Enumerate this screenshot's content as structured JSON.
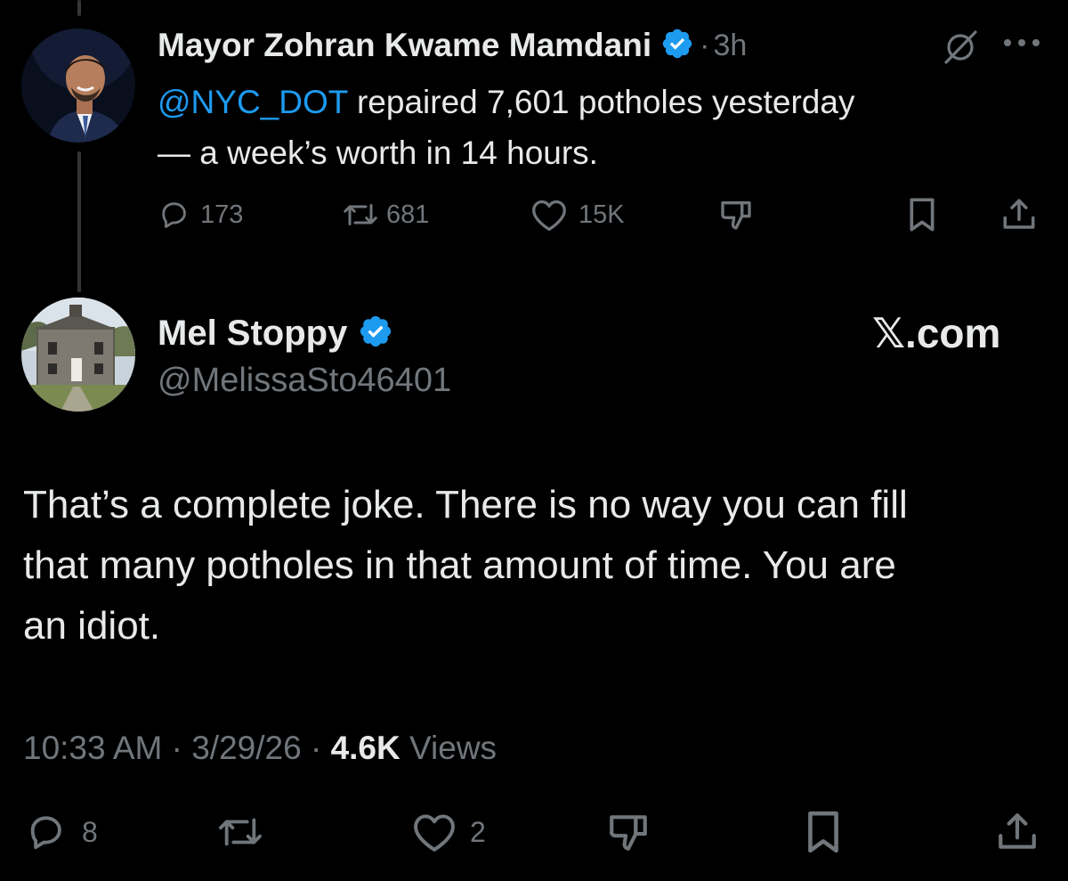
{
  "original_tweet": {
    "author_name": "Mayor Zohran Kwame Mamdani",
    "separator": "·",
    "time": "3h",
    "mention": "@NYC_DOT",
    "text_line1": " repaired 7,601 potholes yesterday",
    "text_line2": "— a week’s worth in 14 hours.",
    "stats": {
      "replies": "173",
      "reposts": "681",
      "likes": "15K"
    },
    "icons": [
      "grok-icon",
      "more-icon",
      "reply-icon",
      "repost-icon",
      "like-icon",
      "dislike-icon",
      "bookmark-icon",
      "share-icon"
    ]
  },
  "reply_tweet": {
    "author_name": "Mel Stoppy",
    "handle": "@MelissaSto46401",
    "watermark": "𝕏.com",
    "text_line1": "That’s a complete joke. There is no way you can fill",
    "text_line2": "that many potholes in that amount of time. You are",
    "text_line3": "an idiot.",
    "meta": {
      "time": "10:33 AM",
      "sep1": "·",
      "date": "3/29/26",
      "sep2": "·",
      "views_count": "4.6K",
      "views_label": "Views"
    },
    "stats": {
      "replies": "8",
      "likes": "2"
    }
  },
  "colors": {
    "background": "#000000",
    "text": "#e7e9ea",
    "muted": "#71767b",
    "link": "#1d9bf0",
    "verified": "#1d9bf0"
  }
}
